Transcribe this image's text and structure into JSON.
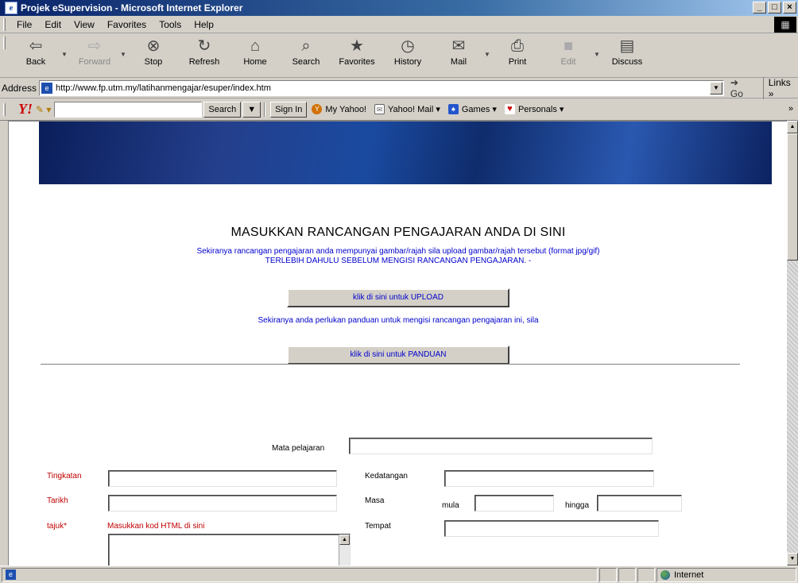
{
  "window": {
    "title": "Projek eSupervision - Microsoft Internet Explorer",
    "controls": [
      "_",
      "□",
      "×"
    ]
  },
  "menu": [
    "File",
    "Edit",
    "View",
    "Favorites",
    "Tools",
    "Help"
  ],
  "toolbar": [
    {
      "label": "Back",
      "icon": "back-arrow",
      "glyph": "⇦",
      "enabled": true
    },
    {
      "label": "Forward",
      "icon": "forward-arrow",
      "glyph": "⇨",
      "enabled": false
    },
    {
      "label": "Stop",
      "icon": "stop",
      "glyph": "⊗",
      "enabled": true
    },
    {
      "label": "Refresh",
      "icon": "refresh",
      "glyph": "↻",
      "enabled": true
    },
    {
      "label": "Home",
      "icon": "home",
      "glyph": "⌂",
      "enabled": true
    },
    {
      "label": "Search",
      "icon": "search",
      "glyph": "⌕",
      "enabled": true
    },
    {
      "label": "Favorites",
      "icon": "favorites",
      "glyph": "★",
      "enabled": true
    },
    {
      "label": "History",
      "icon": "history",
      "glyph": "◷",
      "enabled": true
    },
    {
      "label": "Mail",
      "icon": "mail",
      "glyph": "✉",
      "enabled": true
    },
    {
      "label": "Print",
      "icon": "print",
      "glyph": "⎙",
      "enabled": true
    },
    {
      "label": "Edit",
      "icon": "edit",
      "glyph": "■",
      "enabled": false
    },
    {
      "label": "Discuss",
      "icon": "discuss",
      "glyph": "▤",
      "enabled": true
    }
  ],
  "address": {
    "label": "Address",
    "url": "http://www.fp.utm.my/latihanmengajar/esuper/index.htm",
    "go": "Go",
    "links": "Links"
  },
  "yahoo": {
    "logo": "Y!",
    "search_label": "Search",
    "signin": "Sign In",
    "items": [
      "My Yahoo!",
      "Yahoo! Mail",
      "Games",
      "Personals"
    ]
  },
  "page": {
    "heading": "MASUKKAN RANCANGAN PENGAJARAN ANDA DI SINI",
    "info_line1": "Sekiranya rancangan pengajaran anda mempunyai gambar/rajah sila upload gambar/rajah tersebut (format jpg/gif)",
    "info_line2": "TERLEBIH DAHULU SEBELUM MENGISI RANCANGAN PENGAJARAN. -",
    "upload_button": "klik di sini untuk UPLOAD",
    "guide_text": "Sekiranya anda perlukan panduan untuk mengisi rancangan pengajaran ini, sila",
    "guide_button": "klik di sini untuk PANDUAN"
  },
  "form": {
    "mata_pelajaran": "Mata pelajaran",
    "tingkatan": "Tingkatan",
    "tarikh": "Tarikh",
    "tajuk": "tajuk*",
    "tajuk_hint": "Masukkan kod HTML di sini",
    "kedatangan": "Kedatangan",
    "masa": "Masa",
    "mula": "mula",
    "hingga": "hingga",
    "tempat": "Tempat"
  },
  "status": {
    "text": "",
    "zone": "Internet"
  }
}
